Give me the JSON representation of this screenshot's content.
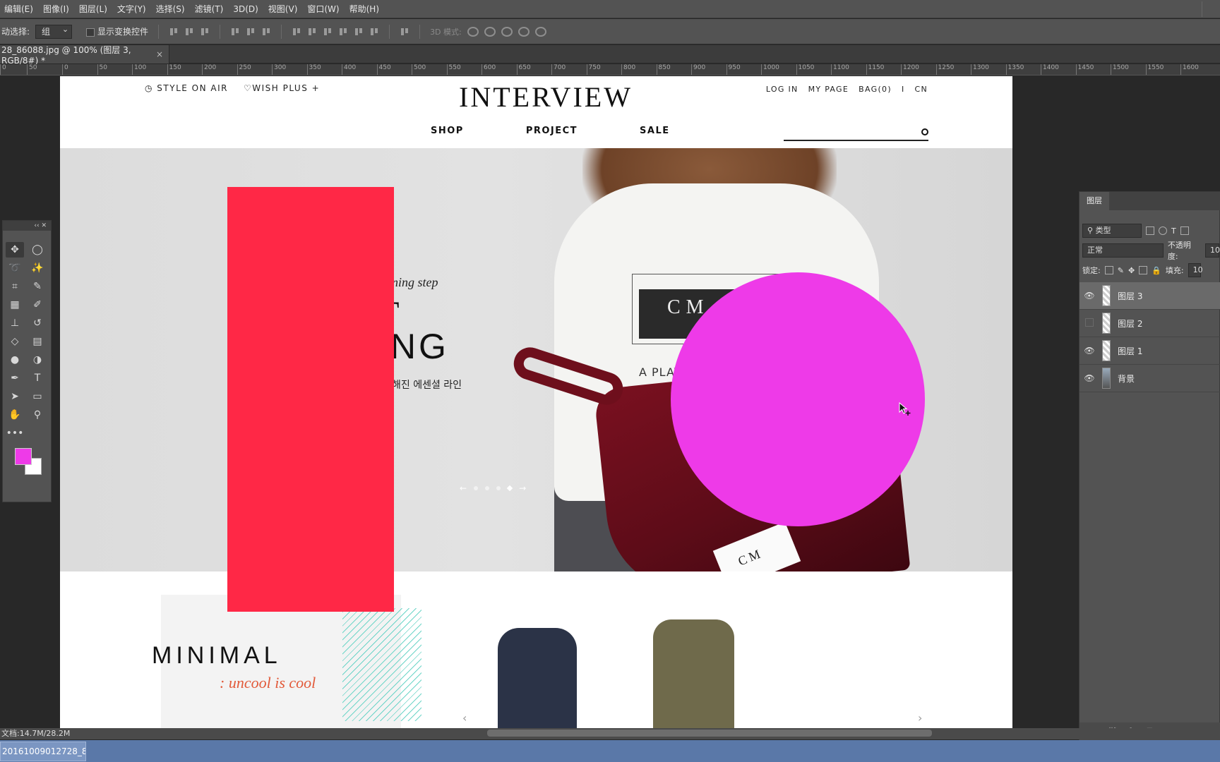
{
  "menu": [
    "编辑(E)",
    "图像(I)",
    "图层(L)",
    "文字(Y)",
    "选择(S)",
    "滤镜(T)",
    "3D(D)",
    "视图(V)",
    "窗口(W)",
    "帮助(H)"
  ],
  "options": {
    "auto_select_label": "动选择:",
    "auto_select_value": "组",
    "show_transform_label": "显示变换控件",
    "mode_3d_label": "3D 模式:"
  },
  "doc_tab": {
    "title": "28_86088.jpg @ 100% (图层 3, RGB/8#) *",
    "close": "×"
  },
  "ruler_ticks": [
    "0",
    "50",
    "0",
    "50",
    "100",
    "150",
    "200",
    "250",
    "300",
    "350",
    "400",
    "450",
    "500",
    "550",
    "600",
    "650",
    "700",
    "750",
    "800",
    "850",
    "900",
    "950",
    "1000",
    "1050",
    "1100",
    "1150",
    "1200",
    "1250",
    "1300",
    "1350",
    "1400",
    "1450",
    "1500",
    "1550",
    "1600"
  ],
  "site": {
    "top_left": [
      "STYLE ON AIR",
      "WISH PLUS +"
    ],
    "logo": "INTERVIEW",
    "top_right": [
      "LOG IN",
      "MY PAGE",
      "BAG(0)",
      "I",
      "CN"
    ],
    "nav": [
      "SHOP",
      "PROJECT",
      "SALE"
    ],
    "hero": {
      "script": "ning step",
      "big1": "T",
      "big2": "ING",
      "sub": "해진 에센셜 라인",
      "print_block": "CM",
      "print_line": "A PLAY",
      "tag": "CM"
    },
    "slider_arrows": [
      "←",
      "→"
    ],
    "promo": {
      "title": "MINIMAL",
      "tagline": ": uncool is cool"
    }
  },
  "layers_panel": {
    "tab": "图层",
    "filter_kind": "类型",
    "blend_mode": "正常",
    "opacity_label": "不透明度:",
    "opacity_value": "10",
    "lock_label": "锁定:",
    "fill_label": "填充:",
    "fill_value": "10",
    "layers": [
      {
        "name": "图层 3",
        "visible": true,
        "selected": true
      },
      {
        "name": "图层 2",
        "visible": false,
        "selected": false
      },
      {
        "name": "图层 1",
        "visible": true,
        "selected": false
      },
      {
        "name": "背景",
        "visible": true,
        "selected": false
      }
    ]
  },
  "status": {
    "doc_size": "文档:14.7M/28.2M"
  },
  "taskbar": {
    "item": "20161009012728_8..."
  },
  "colors": {
    "foreground": "#ee3ae8",
    "red_shape": "#ff2846",
    "promo_accent": "#e25a3a"
  }
}
